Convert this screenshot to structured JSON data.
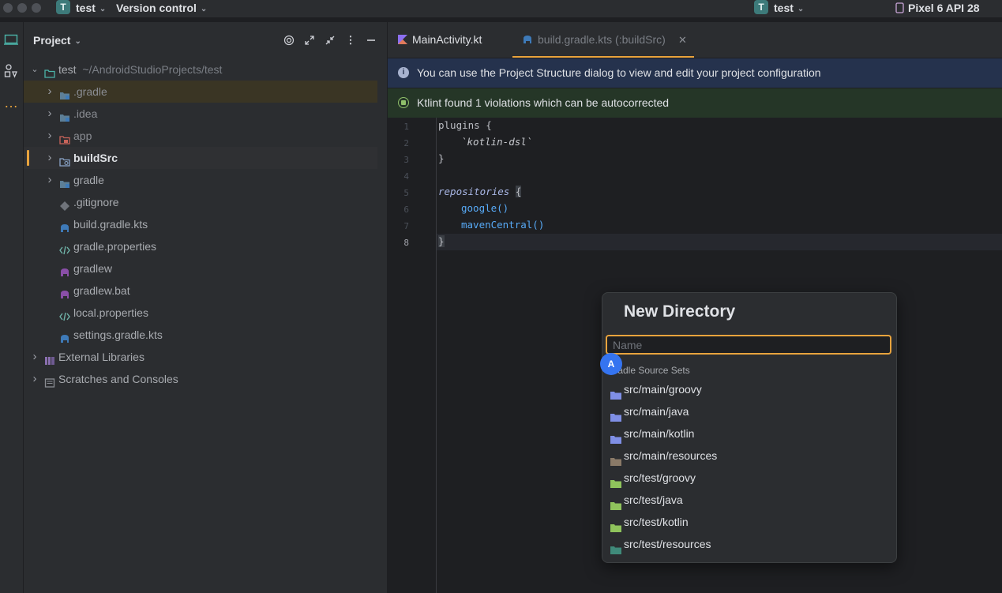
{
  "titlebar": {
    "project_initial": "T",
    "project_name": "test",
    "vcs_label": "Version control",
    "run_config_initial": "T",
    "run_config": "test",
    "device": "Pixel 6 API 28"
  },
  "project_panel": {
    "title": "Project",
    "tree": [
      {
        "name": "test",
        "path": "~/AndroidStudioProjects/test",
        "depth": 0,
        "expanded": true,
        "icon": "module-folder-icon"
      },
      {
        "name": ".gradle",
        "depth": 1,
        "expandable": true,
        "icon": "folder-icon",
        "dim": true
      },
      {
        "name": ".idea",
        "depth": 1,
        "expandable": true,
        "icon": "folder-icon",
        "dim": true
      },
      {
        "name": "app",
        "depth": 1,
        "expandable": true,
        "icon": "app-module-icon",
        "dim": true
      },
      {
        "name": "buildSrc",
        "depth": 1,
        "expandable": true,
        "icon": "buildsrc-folder-icon",
        "bold": true
      },
      {
        "name": "gradle",
        "depth": 1,
        "expandable": true,
        "icon": "folder-icon"
      },
      {
        "name": ".gitignore",
        "depth": 1,
        "icon": "gitignore-icon"
      },
      {
        "name": "build.gradle.kts",
        "depth": 1,
        "icon": "gradle-elephant-icon"
      },
      {
        "name": "gradle.properties",
        "depth": 1,
        "icon": "properties-icon"
      },
      {
        "name": "gradlew",
        "depth": 1,
        "icon": "gradle-script-icon"
      },
      {
        "name": "gradlew.bat",
        "depth": 1,
        "icon": "gradle-script-icon"
      },
      {
        "name": "local.properties",
        "depth": 1,
        "icon": "properties-icon"
      },
      {
        "name": "settings.gradle.kts",
        "depth": 1,
        "icon": "gradle-elephant-icon"
      },
      {
        "name": "External Libraries",
        "depth": 0,
        "expandable": true,
        "icon": "library-icon"
      },
      {
        "name": "Scratches and Consoles",
        "depth": 0,
        "expandable": true,
        "icon": "scratches-icon"
      }
    ]
  },
  "editor": {
    "tabs": [
      {
        "label": "MainActivity.kt",
        "active": false
      },
      {
        "label": "build.gradle.kts (:buildSrc)",
        "active": true
      }
    ],
    "banners": {
      "info": "You can use the Project Structure dialog to view and edit your project configuration",
      "ktlint": "Ktlint found 1 violations which can be autocorrected"
    },
    "lines": [
      "1",
      "2",
      "3",
      "4",
      "5",
      "6",
      "7",
      "8"
    ],
    "code": {
      "l1_kw": "plugins",
      "l1_brace": " {",
      "l2": "`kotlin-dsl`",
      "l3": "}",
      "l5_kw": "repositories",
      "l5_brace": "{",
      "l6": "google()",
      "l7": "mavenCentral()",
      "l8": "}"
    }
  },
  "new_directory_dialog": {
    "title": "New Directory",
    "input_placeholder": "Name",
    "input_value": "",
    "section_label": "Gradle Source Sets",
    "items": [
      {
        "path": "src/main/groovy",
        "color": "#7f8fe6"
      },
      {
        "path": "src/main/java",
        "color": "#7f8fe6"
      },
      {
        "path": "src/main/kotlin",
        "color": "#7f8fe6"
      },
      {
        "path": "src/main/resources",
        "color": "#8a7a68"
      },
      {
        "path": "src/test/groovy",
        "color": "#8fc35c"
      },
      {
        "path": "src/test/java",
        "color": "#8fc35c"
      },
      {
        "path": "src/test/kotlin",
        "color": "#8fc35c"
      },
      {
        "path": "src/test/resources",
        "color": "#3f8a7a"
      }
    ]
  },
  "annotation_badge": "A",
  "colors": {
    "accent_orange": "#e8a33d",
    "info_banner_bg": "#25324d",
    "ktlint_banner_bg": "#253627",
    "badge_blue": "#3574f0"
  }
}
